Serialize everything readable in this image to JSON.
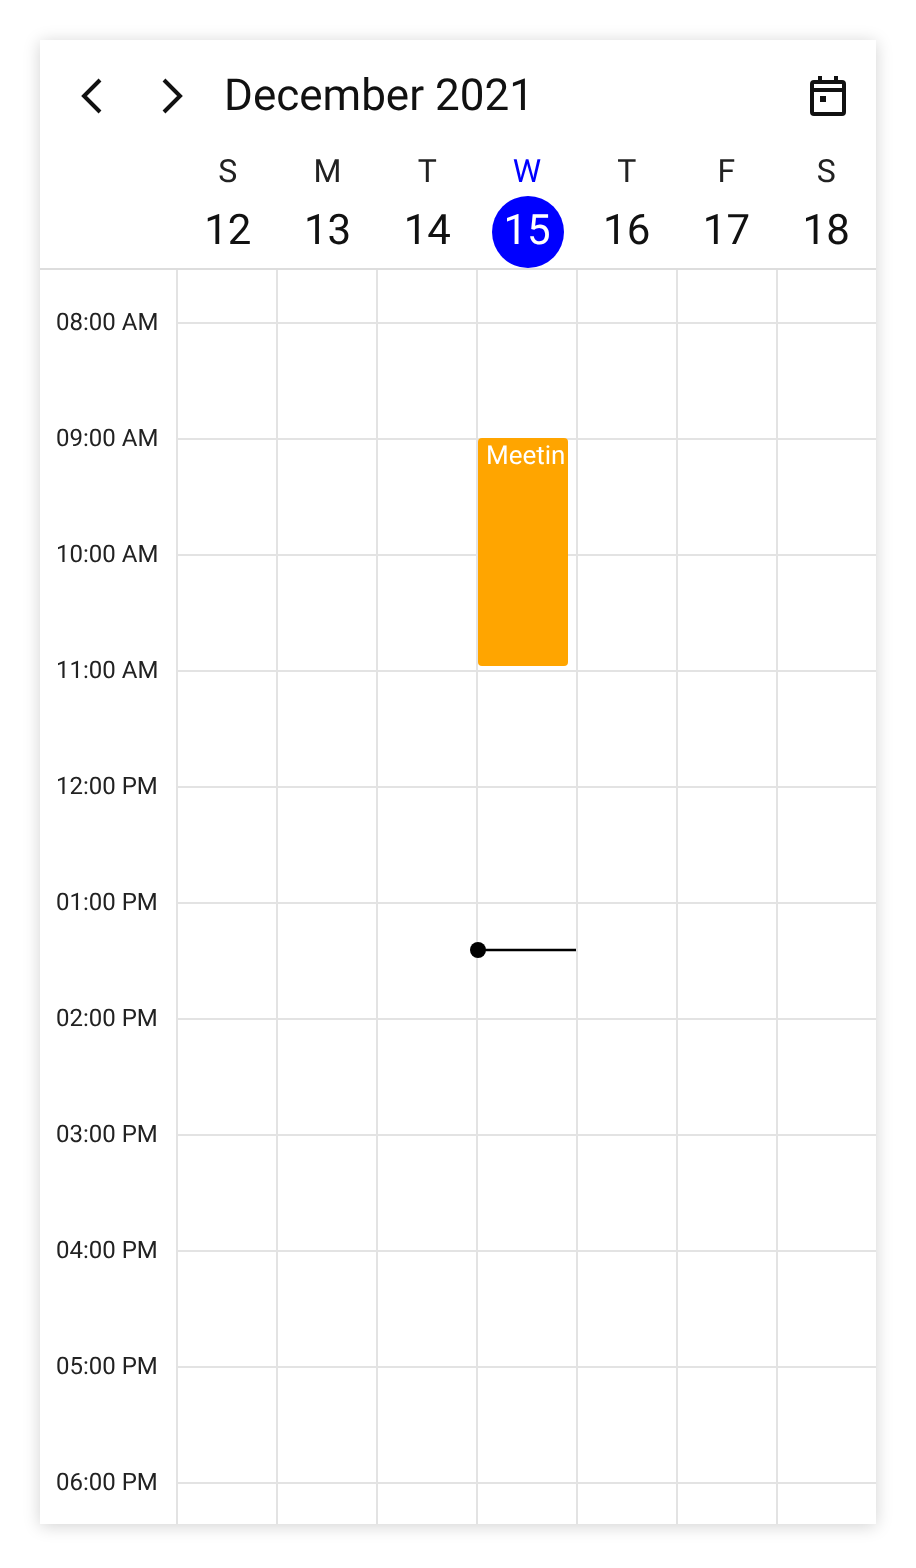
{
  "header": {
    "title": "December 2021"
  },
  "days": [
    {
      "weekday": "S",
      "date": "12",
      "selected": false
    },
    {
      "weekday": "M",
      "date": "13",
      "selected": false
    },
    {
      "weekday": "T",
      "date": "14",
      "selected": false
    },
    {
      "weekday": "W",
      "date": "15",
      "selected": true,
      "current_time": true,
      "events": [
        {
          "title": "Meetin",
          "color": "#ffa500"
        }
      ]
    },
    {
      "weekday": "T",
      "date": "16",
      "selected": false
    },
    {
      "weekday": "F",
      "date": "17",
      "selected": false
    },
    {
      "weekday": "S",
      "date": "18",
      "selected": false
    }
  ],
  "times": [
    "08:00 AM",
    "09:00 AM",
    "10:00 AM",
    "11:00 AM",
    "12:00 PM",
    "01:00 PM",
    "02:00 PM",
    "03:00 PM",
    "04:00 PM",
    "05:00 PM",
    "06:00 PM"
  ]
}
